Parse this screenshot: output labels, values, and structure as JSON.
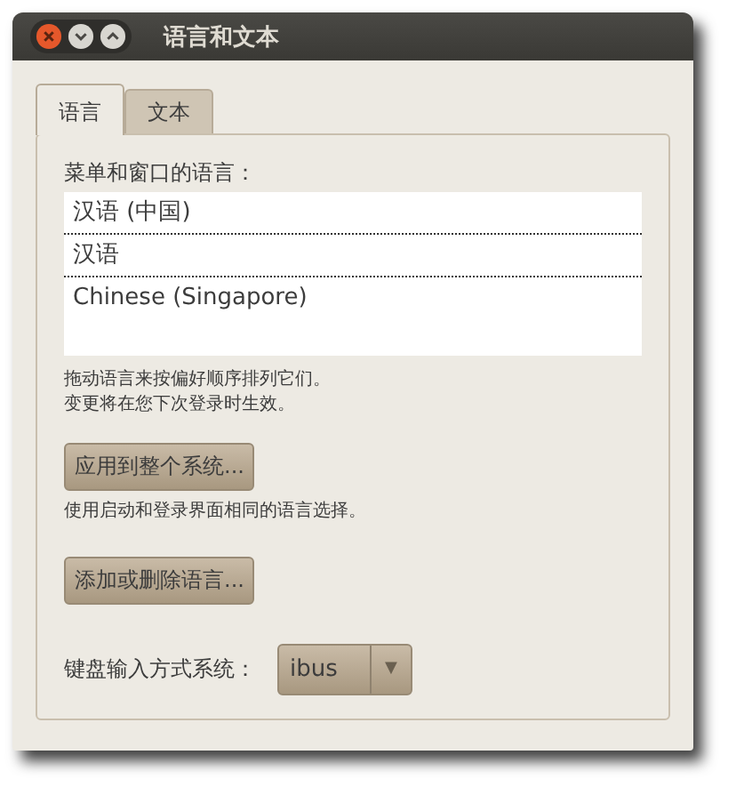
{
  "window": {
    "title": "语言和文本"
  },
  "tabs": [
    {
      "label": "语言",
      "selected": true
    },
    {
      "label": "文本",
      "selected": false
    }
  ],
  "language_list": {
    "label": "菜单和窗口的语言：",
    "items": [
      "汉语 (中国)",
      "汉语",
      "Chinese (Singapore)"
    ]
  },
  "hint": [
    "拖动语言来按偏好顺序排列它们。",
    "变更将在您下次登录时生效。"
  ],
  "apply_button": "应用到整个系统...",
  "apply_note": "使用启动和登录界面相同的语言选择。",
  "add_remove_button": "添加或删除语言...",
  "input_method": {
    "label": "键盘输入方式系统：",
    "value": "ibus",
    "arrow": "▼"
  }
}
